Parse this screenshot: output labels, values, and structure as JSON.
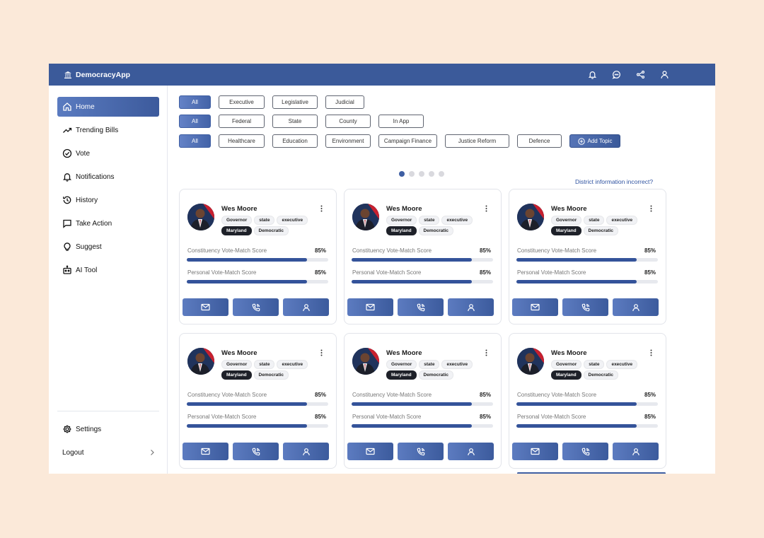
{
  "app": {
    "title": "DemocracyApp"
  },
  "topbar": {
    "icons": [
      "bell-icon",
      "chat-icon",
      "share-icon",
      "user-icon"
    ]
  },
  "sidebar": {
    "items": [
      {
        "label": "Home",
        "icon": "home-icon",
        "active": true
      },
      {
        "label": "Trending Bills",
        "icon": "trending-icon"
      },
      {
        "label": "Vote",
        "icon": "check-circle-icon"
      },
      {
        "label": "Notifications",
        "icon": "bell-icon"
      },
      {
        "label": "History",
        "icon": "history-icon"
      },
      {
        "label": "Take Action",
        "icon": "message-square-icon"
      },
      {
        "label": "Suggest",
        "icon": "lightbulb-icon"
      },
      {
        "label": "AI Tool",
        "icon": "robot-icon"
      }
    ],
    "settings_label": "Settings",
    "logout_label": "Logout"
  },
  "filters": {
    "branch": [
      "All",
      "Executive",
      "Legislative",
      "Judicial"
    ],
    "level": [
      "All",
      "Federal",
      "State",
      "County",
      "In App"
    ],
    "topics": [
      "All",
      "Healthcare",
      "Education",
      "Environment",
      "Campaign Finance",
      "Justice Reform",
      "Defence"
    ],
    "add_topic_label": "Add Topic"
  },
  "carousel": {
    "total": 5,
    "active": 0
  },
  "district_link": "District information incorrect?",
  "card": {
    "name": "Wes Moore",
    "tags": [
      "Governor",
      "state",
      "executive",
      "Maryland",
      "Democratic"
    ],
    "constituency_label": "Constituency Vote-Match Score",
    "constituency_value": "85%",
    "constituency_fraction": 0.85,
    "personal_label": "Personal Vote-Match Score",
    "personal_value": "85%",
    "personal_fraction": 0.85
  },
  "colors": {
    "primary": "#3b5a9a",
    "accent": "#3f5fa3",
    "background": "#fbe9d9"
  }
}
